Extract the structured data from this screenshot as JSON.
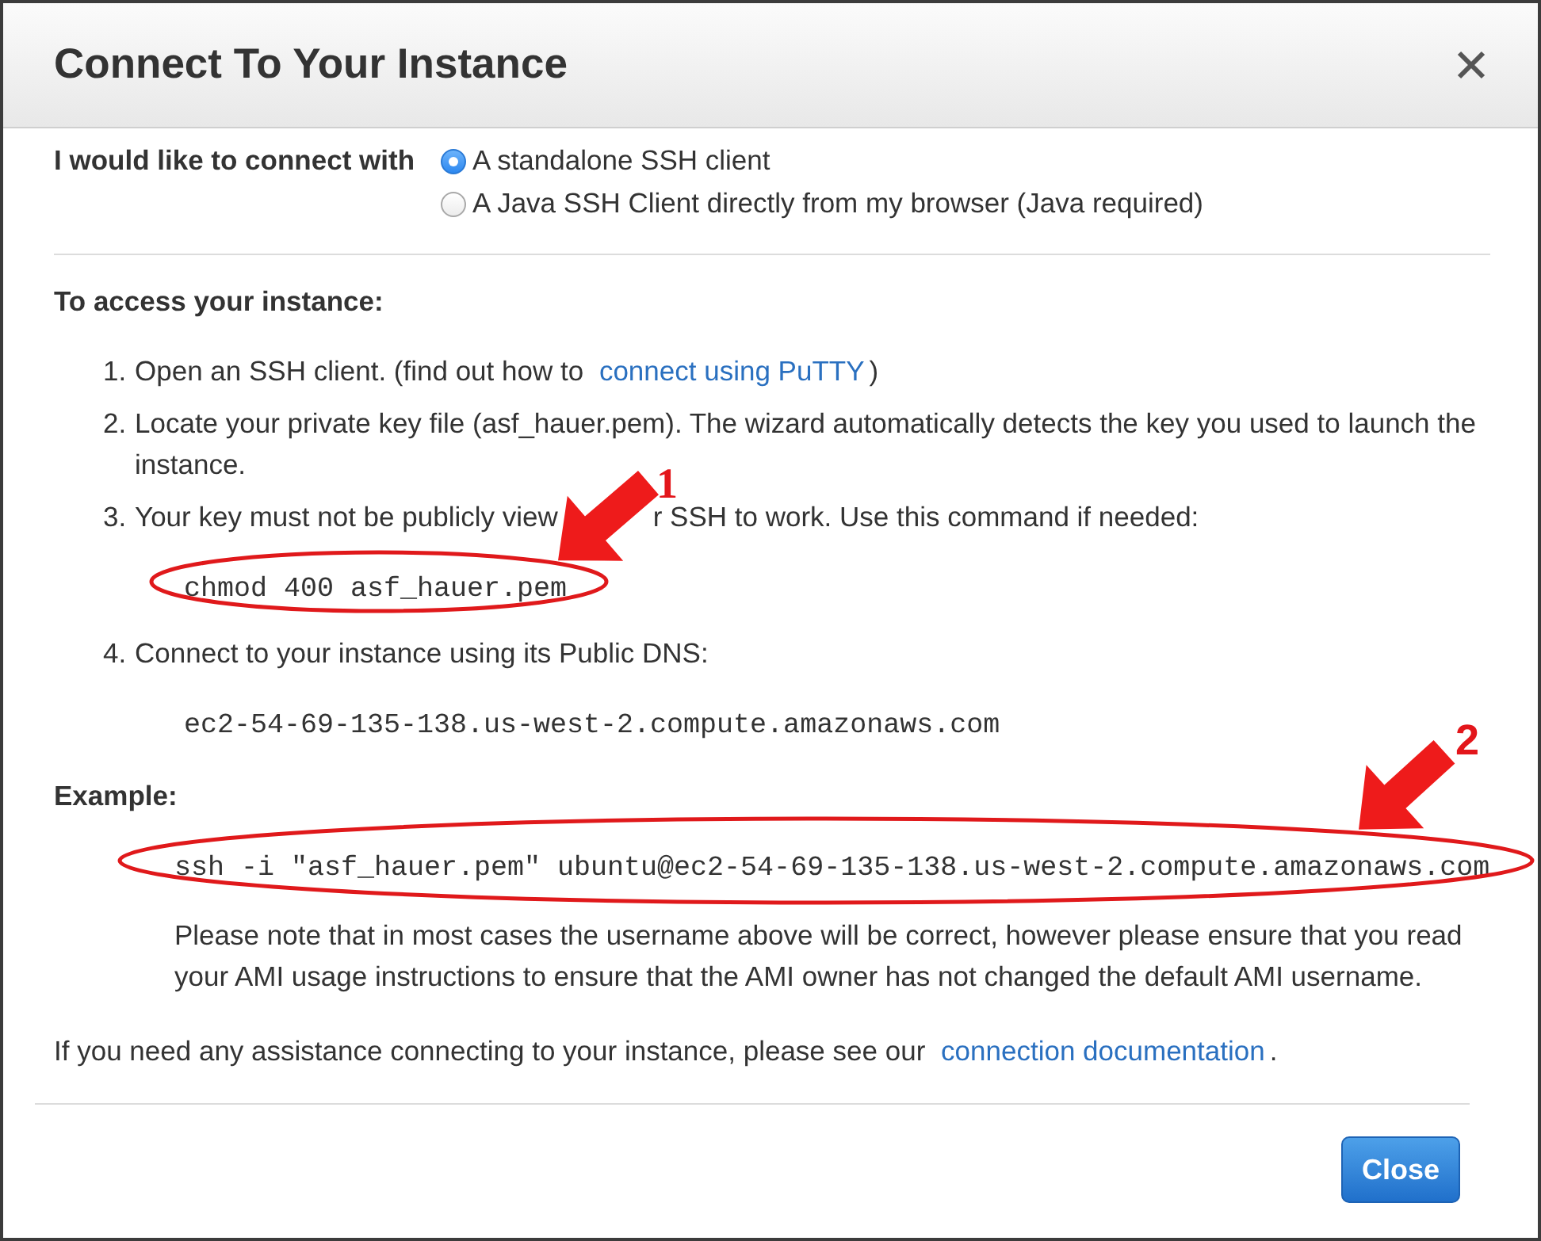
{
  "dialog": {
    "title": "Connect To Your Instance"
  },
  "connect_with": {
    "label": "I would like to connect with",
    "options": [
      {
        "label": "A standalone SSH client",
        "selected": true
      },
      {
        "label": "A Java SSH Client directly from my browser (Java required)",
        "selected": false
      }
    ]
  },
  "access": {
    "heading": "To access your instance:",
    "steps": [
      {
        "number": "1.",
        "parts": [
          {
            "kind": "text",
            "text": "Open an SSH client. (find out how to"
          },
          {
            "kind": "link",
            "text": "connect using PuTTY"
          },
          {
            "kind": "text",
            "text": ")"
          }
        ]
      },
      {
        "number": "2.",
        "parts": [
          {
            "kind": "text",
            "text": "Locate your private key file (asf_hauer.pem). The wizard automatically detects the key you used to launch the instance."
          }
        ]
      },
      {
        "number": "3.",
        "parts": [
          {
            "kind": "text",
            "text": "Your key must not be publicly view"
          },
          {
            "kind": "text",
            "text": "r SSH to work. Use this command if needed:"
          }
        ],
        "code": "chmod 400 asf_hauer.pem",
        "callout": "1"
      },
      {
        "number": "4.",
        "parts": [
          {
            "kind": "text",
            "text": "Connect to your instance using its Public DNS:"
          }
        ],
        "code": "ec2-54-69-135-138.us-west-2.compute.amazonaws.com"
      }
    ]
  },
  "example": {
    "heading": "Example:",
    "command": "ssh -i \"asf_hauer.pem\" ubuntu@ec2-54-69-135-138.us-west-2.compute.amazonaws.com",
    "callout": "2",
    "note": "Please note that in most cases the username above will be correct, however please ensure that you read your AMI usage instructions to ensure that the AMI owner has not changed the default AMI username."
  },
  "help": {
    "parts": [
      {
        "kind": "text",
        "text": "If you need any assistance connecting to your instance, please see our"
      },
      {
        "kind": "link",
        "text": "connection documentation"
      },
      {
        "kind": "text",
        "text": "."
      }
    ]
  },
  "footer": {
    "buttons": [
      {
        "label": "Close",
        "kind": "primary"
      }
    ]
  }
}
